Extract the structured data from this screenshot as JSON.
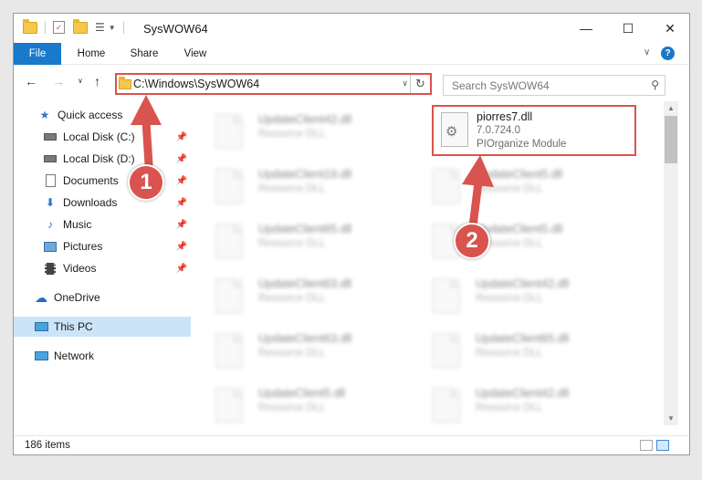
{
  "window": {
    "title": "SysWOW64"
  },
  "ribbon": {
    "tabs": [
      "File",
      "Home",
      "Share",
      "View"
    ]
  },
  "address": {
    "path": "C:\\Windows\\SysWOW64"
  },
  "search": {
    "placeholder": "Search SysWOW64"
  },
  "sidebar": {
    "items": [
      {
        "label": "Quick access",
        "icon": "star-icon"
      },
      {
        "label": "Local Disk (C:)",
        "icon": "drive-icon"
      },
      {
        "label": "Local Disk (D:)",
        "icon": "drive-icon"
      },
      {
        "label": "Documents",
        "icon": "documents-icon"
      },
      {
        "label": "Downloads",
        "icon": "download-icon"
      },
      {
        "label": "Music",
        "icon": "music-icon"
      },
      {
        "label": "Pictures",
        "icon": "pictures-icon"
      },
      {
        "label": "Videos",
        "icon": "videos-icon"
      },
      {
        "label": "OneDrive",
        "icon": "cloud-icon"
      },
      {
        "label": "This PC",
        "icon": "computer-icon"
      },
      {
        "label": "Network",
        "icon": "network-icon"
      }
    ]
  },
  "files": {
    "highlighted": {
      "name": "piorres7.dll",
      "version": "7.0.724.0",
      "description": "PIOrganize Module"
    },
    "left": [
      {
        "name": "UpdateClient42.dll",
        "type": "Resource DLL"
      },
      {
        "name": "UpdateClient19.dll",
        "type": "Resource DLL"
      },
      {
        "name": "UpdateClient65.dll",
        "type": "Resource DLL"
      },
      {
        "name": "UpdateClient63.dll",
        "type": "Resource DLL"
      },
      {
        "name": "UpdateClient63.dll",
        "type": "Resource DLL"
      },
      {
        "name": "UpdateClient5.dll",
        "type": "Resource DLL"
      }
    ],
    "right": [
      {
        "name": "UpdateClient5.dll",
        "type": "Resource DLL"
      },
      {
        "name": "UpdateClient5.dll",
        "type": "Resource DLL"
      },
      {
        "name": "UpdateClient42.dll",
        "type": "Resource DLL"
      },
      {
        "name": "UpdateClient65.dll",
        "type": "Resource DLL"
      },
      {
        "name": "UpdateClient42.dll",
        "type": "Resource DLL"
      }
    ]
  },
  "status": {
    "count": "186 items"
  },
  "callouts": [
    "1",
    "2"
  ],
  "colors": {
    "accent": "#1979ca",
    "highlight": "#d9534f",
    "selected": "#cce4f7"
  }
}
